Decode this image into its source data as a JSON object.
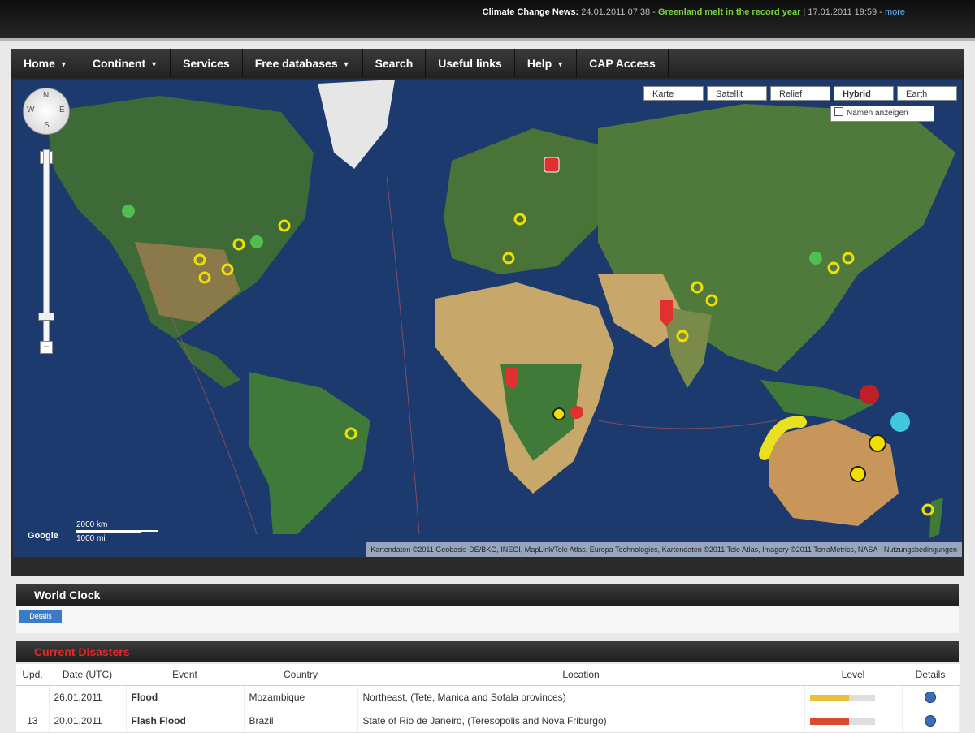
{
  "ticker": {
    "label": "Climate Change News:",
    "left_text": "24.01.2011 07:38 -",
    "headline": "Greenland melt in the record year",
    "right_text": "| 17.01.2011 19:59 -",
    "more": "more"
  },
  "nav": {
    "items": [
      {
        "label": "Home",
        "dropdown": true
      },
      {
        "label": "Continent",
        "dropdown": true
      },
      {
        "label": "Services",
        "dropdown": false
      },
      {
        "label": "Free databases",
        "dropdown": true
      },
      {
        "label": "Search",
        "dropdown": false
      },
      {
        "label": "Useful links",
        "dropdown": false
      },
      {
        "label": "Help",
        "dropdown": true
      },
      {
        "label": "CAP Access",
        "dropdown": false
      }
    ]
  },
  "map": {
    "types": [
      "Karte",
      "Satellit",
      "Relief",
      "Hybrid",
      "Earth"
    ],
    "active_type": "Hybrid",
    "labels_option": "Namen anzeigen",
    "pan_letters": {
      "n": "N",
      "s": "S",
      "w": "W",
      "e": "E"
    },
    "zoom_in": "+",
    "zoom_out": "−",
    "scale": {
      "top": "2000 km",
      "bottom": "1000 mi"
    },
    "google": "Google",
    "attribution": "Kartendaten ©2011 Geobasis-DE/BKG, INEGI, MapLink/Tele Atlas, Europa Technologies, Kartendaten ©2011 Tele Atlas, Imagery ©2011 TerraMetrics, NASA - Nutzungsbedingungen"
  },
  "world_clock": {
    "title": "World Clock",
    "button": "Details"
  },
  "events": {
    "title": "Current Disasters",
    "headers": [
      "Upd.",
      "Date (UTC)",
      "Event",
      "Country",
      "Location",
      "Level",
      "Details"
    ],
    "rows": [
      {
        "upd": "",
        "date": "26.01.2011",
        "event": "Flood",
        "country": "Mozambique",
        "location": "Northeast, (Tete, Manica and Sofala provinces)",
        "level_color": "#e8c33a"
      },
      {
        "upd": "13",
        "date": "20.01.2011",
        "event": "Flash Flood",
        "country": "Brazil",
        "location": "State of Rio de Janeiro, (Teresopolis and Nova Friburgo)",
        "level_color": "#d84a2a"
      }
    ]
  },
  "colors": {
    "nav_bg": "#2b2b2b",
    "accent_red": "#e02a2a",
    "ocean": "#1c3a6e",
    "land": "#3d6a36",
    "desert": "#c8a76a"
  }
}
